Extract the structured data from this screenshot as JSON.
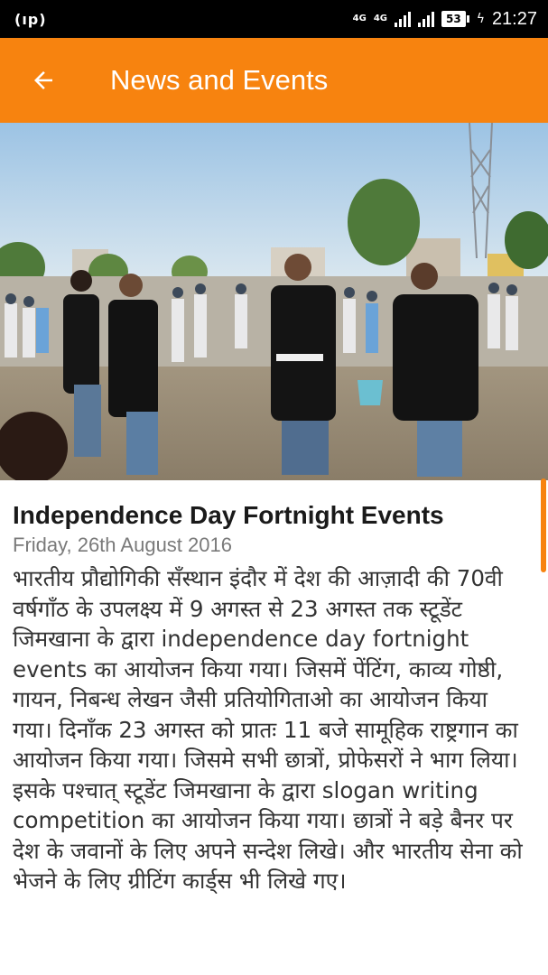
{
  "status_bar": {
    "left_icon": "(ıp)",
    "net_label_1": "4G",
    "net_label_2": "4G",
    "battery": "53",
    "time": "21:27",
    "icons": [
      "hotspot-icon",
      "data-arrows-icon",
      "signal-icon",
      "battery-icon",
      "charging-icon"
    ]
  },
  "app_bar": {
    "title": "News and Events",
    "back_icon": "arrow-left-icon",
    "color": "#f7830f"
  },
  "article": {
    "title": "Independence Day Fortnight Events",
    "date": "Friday, 26th August 2016",
    "body": "भारतीय प्रौद्योगिकी सँस्थान इंदौर में देश की आज़ादी की 70वी वर्षगाँठ के उपलक्ष्य में 9 अगस्त से 23 अगस्त तक स्टूडेंट जिमखाना के द्वारा independence day fortnight events का आयोजन किया गया। जिसमें पेंटिंग, काव्य गोष्ठी, गायन, निबन्ध लेखन जैसी प्रतियोगिताओ का आयोजन किया गया। दिनाँक 23 अगस्त को प्रातः 11 बजे सामूहिक राष्ट्रगान का आयोजन किया गया। जिसमे सभी छात्रों, प्रोफेसरों ने भाग लिया। इसके पश्चात् स्टूडेंट जिमखाना के द्वारा slogan writing competition का आयोजन किया गया। छात्रों ने बड़े बैनर पर देश के जवानों के लिए अपने सन्देश लिखे। और भारतीय सेना को भेजने के लिए ग्रीटिंग कार्ड्स भी लिखे गए।"
  }
}
